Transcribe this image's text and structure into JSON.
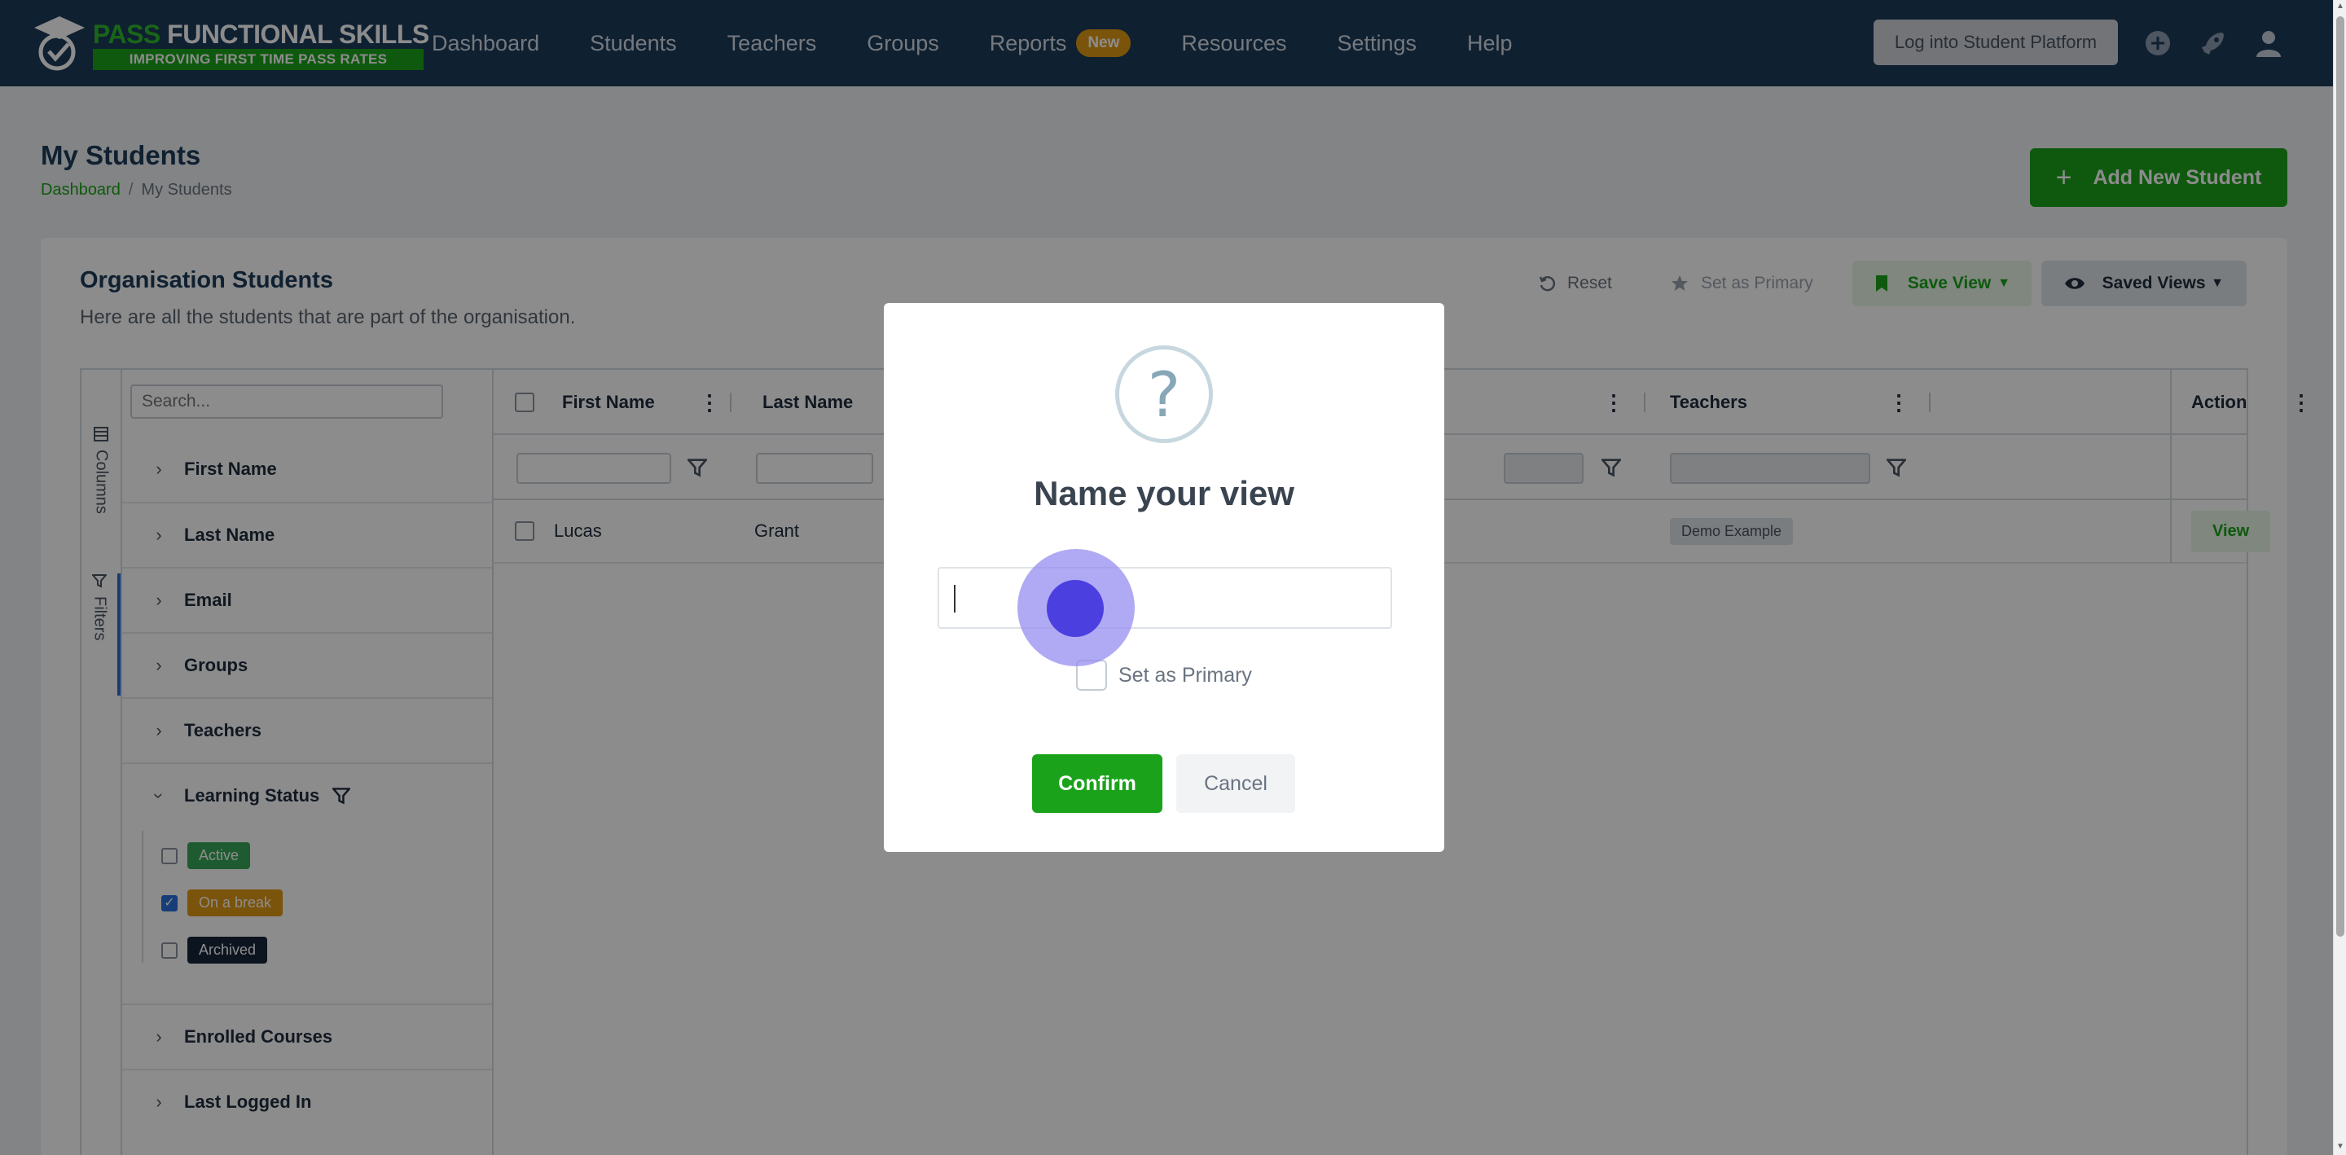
{
  "brand": {
    "title_pass": "PASS",
    "title_rest": " FUNCTIONAL SKILLS",
    "tagline": "IMPROVING FIRST TIME PASS RATES"
  },
  "nav": {
    "items": [
      {
        "label": "Dashboard"
      },
      {
        "label": "Students"
      },
      {
        "label": "Teachers"
      },
      {
        "label": "Groups"
      },
      {
        "label": "Reports",
        "badge": "New"
      },
      {
        "label": "Resources"
      },
      {
        "label": "Settings"
      },
      {
        "label": "Help"
      }
    ],
    "student_platform_button": "Log into Student Platform"
  },
  "page": {
    "title": "My Students",
    "breadcrumb": {
      "home": "Dashboard",
      "current": "My Students"
    },
    "add_button": "Add New Student"
  },
  "card": {
    "title": "Organisation Students",
    "subtitle": "Here are all the students that are part of the organisation.",
    "toolbar": {
      "reset": "Reset",
      "set_primary": "Set as Primary",
      "save_view": "Save View",
      "saved_views": "Saved Views"
    }
  },
  "side_tabs": {
    "columns": "Columns",
    "filters": "Filters"
  },
  "filter_panel": {
    "search_placeholder": "Search...",
    "items": [
      "First Name",
      "Last Name",
      "Email",
      "Groups",
      "Teachers",
      "Learning Status",
      "Enrolled Courses",
      "Last Logged In"
    ],
    "learning_status_options": [
      {
        "label": "Active",
        "checked": false,
        "color": "#3aa65a"
      },
      {
        "label": "On a break",
        "checked": true,
        "color": "#e09a14"
      },
      {
        "label": "Archived",
        "checked": false,
        "color": "#16263a"
      }
    ]
  },
  "table": {
    "columns": [
      "First Name",
      "Last Name",
      "Teachers",
      "Action"
    ],
    "rows": [
      {
        "first_name": "Lucas",
        "last_name": "Grant",
        "teachers": "Demo Example",
        "action": "View"
      }
    ]
  },
  "modal": {
    "icon": "?",
    "title": "Name your view",
    "input_value": "",
    "set_primary_label": "Set as Primary",
    "confirm": "Confirm",
    "cancel": "Cancel"
  },
  "colors": {
    "nav_bg": "#1c3b5a",
    "accent_green": "#1aa31a",
    "badge_orange": "#e09a14"
  }
}
